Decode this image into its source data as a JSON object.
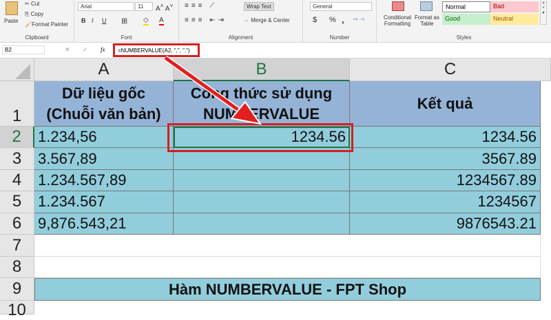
{
  "ribbon": {
    "clipboard": {
      "paste": "Paste",
      "cut": "Cut",
      "copy": "Copy",
      "format_painter": "Format Painter",
      "label": "Clipboard"
    },
    "font": {
      "name": "Arial",
      "size": "11",
      "bold": "B",
      "italic": "I",
      "underline": "U",
      "label": "Font"
    },
    "alignment": {
      "wrap_text": "Wrap Text",
      "merge_center": "Merge & Center",
      "label": "Alignment"
    },
    "number": {
      "format": "General",
      "currency": "$",
      "percent": "%",
      "comma": ",",
      "label": "Number"
    },
    "styles": {
      "conditional": "Conditional Formatting",
      "format_table": "Format as Table",
      "normal": "Normal",
      "bad": "Bad",
      "good": "Good",
      "neutral": "Neutral",
      "label": "Styles"
    }
  },
  "formula_bar": {
    "name_box": "B2",
    "fx": "fx",
    "formula": "=NUMBERVALUE(A2, \",\", \".\")"
  },
  "columns": [
    "A",
    "B",
    "C"
  ],
  "rows": [
    "1",
    "2",
    "3",
    "4",
    "5",
    "6",
    "7",
    "8",
    "9",
    "10"
  ],
  "header": {
    "a_line1": "Dữ liệu gốc",
    "a_line2": "(Chuỗi văn bản)",
    "b_line1": "Công thức sử dụng",
    "b_line2": "NUMBERVALUE",
    "c": "Kết quả"
  },
  "data": [
    {
      "a": "1.234,56",
      "b": "1234.56",
      "c": "1234.56"
    },
    {
      "a": "3.567,89",
      "b": "",
      "c": "3567.89"
    },
    {
      "a": "1.234.567,89",
      "b": "",
      "c": "1234567.89"
    },
    {
      "a": "1.234.567",
      "b": "",
      "c": "1234567"
    },
    {
      "a": "9,876.543,21",
      "b": "",
      "c": "9876543.21"
    }
  ],
  "footer": "Hàm NUMBERVALUE - FPT Shop",
  "colors": {
    "header_fill": "#95b3d7",
    "data_fill": "#92cddc",
    "highlight": "#e02020"
  }
}
